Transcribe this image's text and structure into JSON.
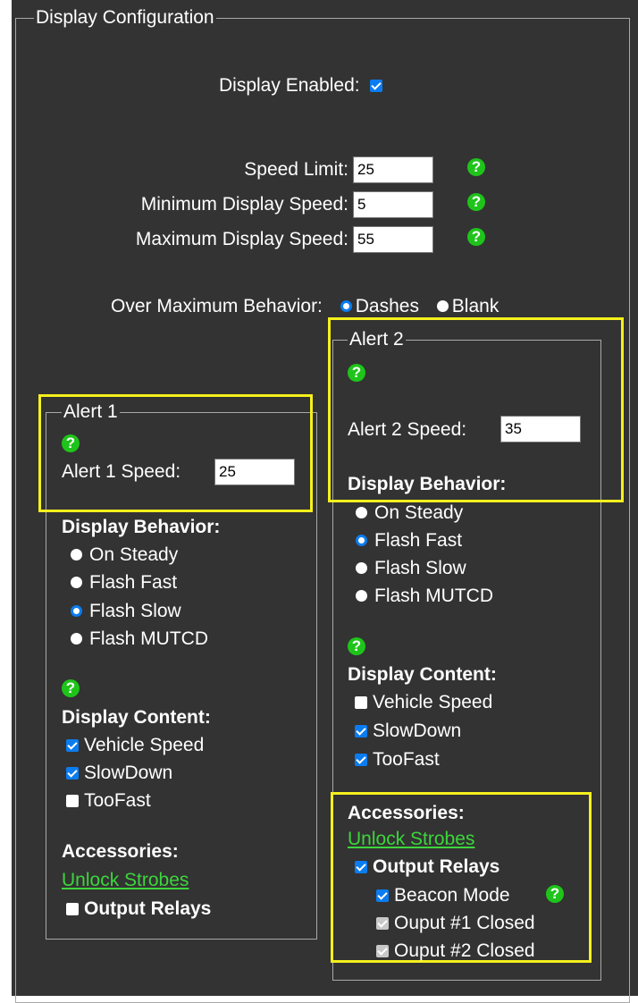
{
  "display_config": {
    "legend": "Display Configuration",
    "enabled": {
      "label": "Display Enabled:",
      "checked": true
    },
    "speed_limit": {
      "label": "Speed Limit:",
      "value": "25"
    },
    "min_speed": {
      "label": "Minimum Display Speed:",
      "value": "5"
    },
    "max_speed": {
      "label": "Maximum Display Speed:",
      "value": "55"
    },
    "help_glyph": "?",
    "over_max": {
      "label": "Over Maximum Behavior:",
      "options": [
        "Dashes",
        "Blank"
      ],
      "selected": "Dashes"
    }
  },
  "alert1": {
    "legend": "Alert 1",
    "speed_label": "Alert 1 Speed:",
    "speed_value": "25",
    "behavior_header": "Display Behavior:",
    "behaviors": [
      "On Steady",
      "Flash Fast",
      "Flash Slow",
      "Flash MUTCD"
    ],
    "behavior_selected": "Flash Slow",
    "content_header": "Display Content:",
    "content": [
      {
        "label": "Vehicle Speed",
        "checked": true
      },
      {
        "label": "SlowDown",
        "checked": true
      },
      {
        "label": "TooFast",
        "checked": false
      }
    ],
    "accessories_header": "Accessories:",
    "unlock_link": "Unlock Strobes",
    "output_relays": {
      "label": "Output Relays",
      "checked": false
    }
  },
  "alert2": {
    "legend": "Alert 2",
    "speed_label": "Alert 2 Speed:",
    "speed_value": "35",
    "behavior_header": "Display Behavior:",
    "behaviors": [
      "On Steady",
      "Flash Fast",
      "Flash Slow",
      "Flash MUTCD"
    ],
    "behavior_selected": "Flash Fast",
    "content_header": "Display Content:",
    "content": [
      {
        "label": "Vehicle Speed",
        "checked": false
      },
      {
        "label": "SlowDown",
        "checked": true
      },
      {
        "label": "TooFast",
        "checked": true
      }
    ],
    "accessories_header": "Accessories:",
    "unlock_link": "Unlock Strobes",
    "output_relays": {
      "label": "Output Relays",
      "checked": true
    },
    "beacon_mode": {
      "label": "Beacon Mode",
      "checked": true
    },
    "output1": {
      "label": "Ouput #1 Closed",
      "checked": true,
      "disabled": true
    },
    "output2": {
      "label": "Ouput #2 Closed",
      "checked": true,
      "disabled": true
    }
  },
  "colors": {
    "panel_bg": "#333333",
    "highlight": "#f5f01d",
    "help_green": "#1ec41a",
    "link_green": "#3cd63c",
    "accent_blue": "#0b7cf0"
  }
}
